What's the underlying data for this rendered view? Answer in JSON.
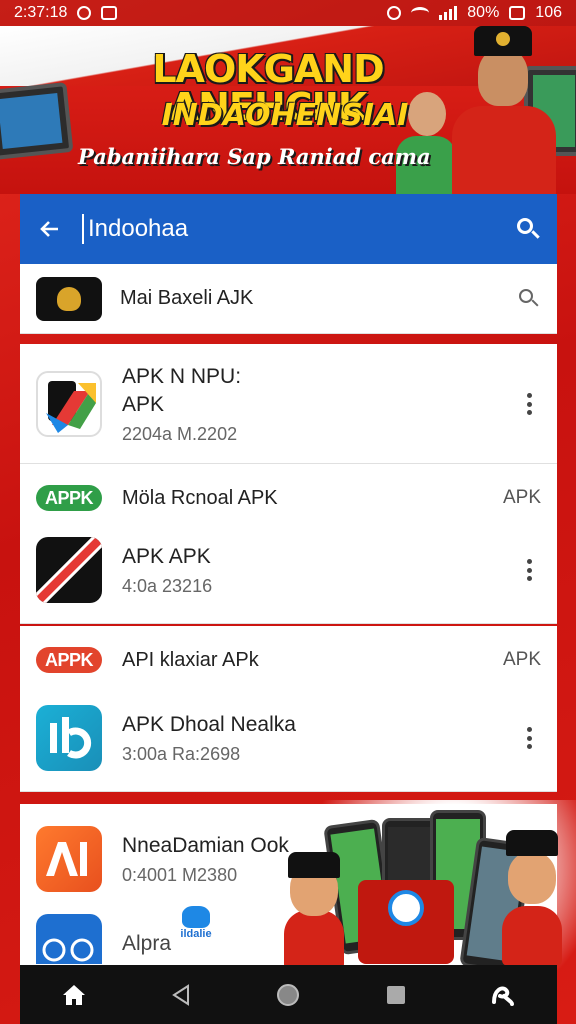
{
  "status_bar": {
    "time": "2:37:18",
    "right_text": "80%",
    "extra": "106"
  },
  "banner": {
    "headline_line1": "LAOKGAND ANEHCIIK",
    "headline_line2": "INDAOHENSIAI",
    "tagline": "Pabaniihara Sap Raniad cama"
  },
  "search": {
    "query": "Indoohaa"
  },
  "top_result": {
    "label": "Mai Baxeli AJK"
  },
  "apps": [
    {
      "title_line1": "APK N NPU:",
      "title_line2": "APK",
      "meta": "2204a M.2202"
    },
    {
      "header_pill": "APPK",
      "header_label": "Möla Rcnoal APK",
      "header_tag": "APK",
      "pill_color": "#2f9e48",
      "title": "APK APK",
      "meta": "4:0a 23216"
    },
    {
      "header_pill": "APPK",
      "header_label": "API klaxiar APk",
      "header_tag": "APK",
      "pill_color": "#e2442c",
      "title": "APK Dhoal Nealka",
      "meta": "3:00a Ra:2698"
    },
    {
      "title": "NneaDamian Ook",
      "meta": "0:4001 M2380"
    },
    {
      "title": "Alpra"
    }
  ],
  "promo": {
    "tiny_label": "ildalie"
  },
  "colors": {
    "header_blue": "#1a60c6",
    "banner_red": "#c8120f",
    "headline_yellow": "#ffd31a"
  },
  "icons": [
    "back-arrow-icon",
    "search-icon",
    "more-vert-icon",
    "home-icon",
    "back-triangle-icon",
    "circle-home-icon",
    "square-recents-icon",
    "app-logo-icon"
  ]
}
